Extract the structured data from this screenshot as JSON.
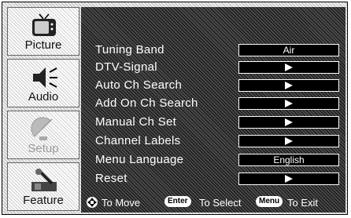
{
  "sidebar": {
    "items": [
      {
        "label": "Picture",
        "icon": "tv-icon"
      },
      {
        "label": "Audio",
        "icon": "speaker-icon"
      },
      {
        "label": "Setup",
        "icon": "satellite-dish-icon",
        "disabled": true
      },
      {
        "label": "Feature",
        "icon": "tools-icon"
      }
    ]
  },
  "menu": {
    "items": [
      {
        "label": "Tuning Band",
        "value": "Air"
      },
      {
        "label": "DTV-Signal",
        "value": ""
      },
      {
        "label": "Auto Ch Search",
        "value": ""
      },
      {
        "label": "Add On Ch Search",
        "value": ""
      },
      {
        "label": "Manual Ch Set",
        "value": ""
      },
      {
        "label": "Channel Labels",
        "value": ""
      },
      {
        "label": "Menu Language",
        "value": "English"
      },
      {
        "label": "Reset",
        "value": ""
      }
    ]
  },
  "footer": {
    "move": "To Move",
    "enter_key": "Enter",
    "select": "To Select",
    "menu_key": "Menu",
    "exit": "To Exit"
  }
}
